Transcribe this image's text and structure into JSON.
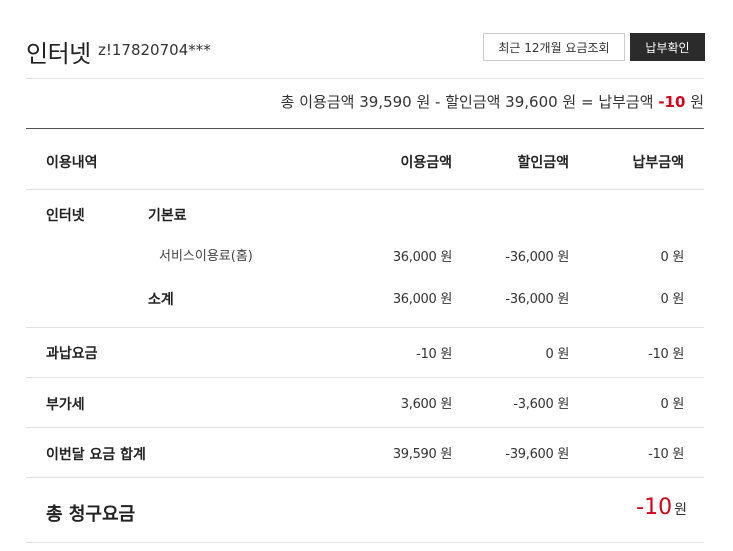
{
  "header": {
    "title": "인터넷",
    "account_id": "z!17820704***",
    "history_button": "최근 12개월 요금조회",
    "pay_button": "납부확인"
  },
  "summary": {
    "text_before": "총 이용금액 39,590 원 - 할인금액 39,600 원 = 납부금액 ",
    "amount": "-10",
    "unit": " 원"
  },
  "table": {
    "headers": {
      "item": "이용내역",
      "usage": "이용금액",
      "discount": "할인금액",
      "payment": "납부금액"
    },
    "internet": {
      "category": "인터넷",
      "basic_label": "기본료",
      "service": {
        "name": "서비스이용료(홈)",
        "usage": "36,000 원",
        "discount": "-36,000 원",
        "payment": "0 원"
      },
      "subtotal": {
        "name": "소계",
        "usage": "36,000 원",
        "discount": "-36,000 원",
        "payment": "0 원"
      }
    },
    "overpay": {
      "name": "과납요금",
      "usage": "-10 원",
      "discount": "0 원",
      "payment": "-10 원"
    },
    "vat": {
      "name": "부가세",
      "usage": "3,600 원",
      "discount": "-3,600 원",
      "payment": "0 원"
    },
    "month_total": {
      "name": "이번달 요금 합계",
      "usage": "39,590 원",
      "discount": "-39,600 원",
      "payment": "-10 원"
    }
  },
  "total": {
    "label": "총 청구요금",
    "amount": "-10",
    "unit": "원"
  },
  "colors": {
    "accent_negative": "#d0021b",
    "dark_button": "#2b2b2b"
  }
}
